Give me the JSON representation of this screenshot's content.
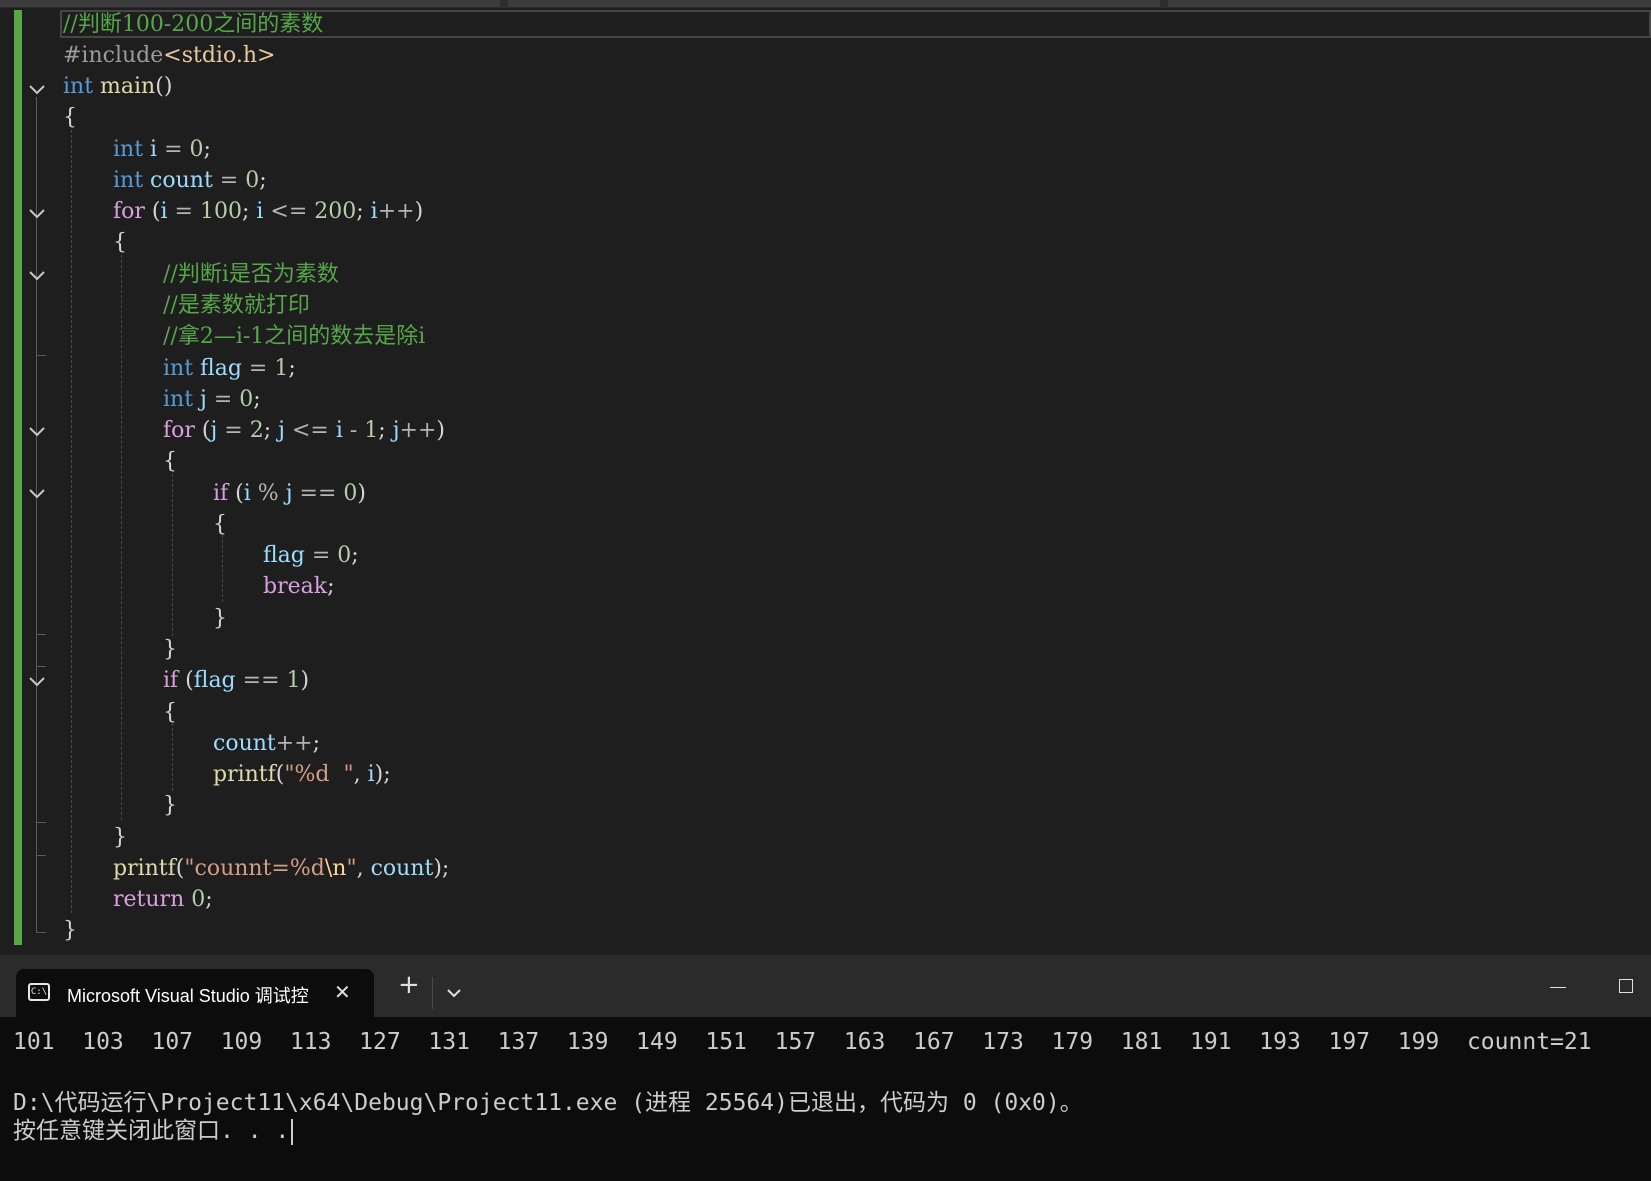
{
  "editor": {
    "lines": [
      {
        "parts": [
          {
            "t": "//判断100-200之间的素数",
            "c": "cmt"
          }
        ]
      },
      {
        "parts": [
          {
            "t": "#include",
            "c": "inc"
          },
          {
            "t": "<stdio.h>",
            "c": "incs"
          }
        ]
      },
      {
        "parts": [
          {
            "t": "int",
            "c": "kw"
          },
          {
            "t": " "
          },
          {
            "t": "main",
            "c": "fn"
          },
          {
            "t": "()"
          }
        ]
      },
      {
        "parts": [
          {
            "t": "{"
          }
        ]
      },
      {
        "parts": [
          {
            "t": "int",
            "c": "kw"
          },
          {
            "t": " "
          },
          {
            "t": "i",
            "c": "var"
          },
          {
            "t": " = ",
            "c": "op"
          },
          {
            "t": "0",
            "c": "num"
          },
          {
            "t": ";"
          }
        ]
      },
      {
        "parts": [
          {
            "t": "int",
            "c": "kw"
          },
          {
            "t": " "
          },
          {
            "t": "count",
            "c": "var"
          },
          {
            "t": " = ",
            "c": "op"
          },
          {
            "t": "0",
            "c": "num"
          },
          {
            "t": ";"
          }
        ]
      },
      {
        "parts": [
          {
            "t": "for",
            "c": "ctl"
          },
          {
            "t": " ("
          },
          {
            "t": "i",
            "c": "var"
          },
          {
            "t": " = ",
            "c": "op"
          },
          {
            "t": "100",
            "c": "num"
          },
          {
            "t": "; "
          },
          {
            "t": "i",
            "c": "var"
          },
          {
            "t": " <= ",
            "c": "op"
          },
          {
            "t": "200",
            "c": "num"
          },
          {
            "t": "; "
          },
          {
            "t": "i",
            "c": "var"
          },
          {
            "t": "++",
            "c": "op"
          },
          {
            "t": ")"
          }
        ]
      },
      {
        "parts": [
          {
            "t": "{"
          }
        ]
      },
      {
        "parts": [
          {
            "t": "//判断i是否为素数",
            "c": "cmt"
          }
        ]
      },
      {
        "parts": [
          {
            "t": "//是素数就打印",
            "c": "cmt"
          }
        ]
      },
      {
        "parts": [
          {
            "t": "//拿2—i-1之间的数去是除i",
            "c": "cmt"
          }
        ]
      },
      {
        "parts": [
          {
            "t": "int",
            "c": "kw"
          },
          {
            "t": " "
          },
          {
            "t": "flag",
            "c": "var"
          },
          {
            "t": " = ",
            "c": "op"
          },
          {
            "t": "1",
            "c": "num"
          },
          {
            "t": ";"
          }
        ]
      },
      {
        "parts": [
          {
            "t": "int",
            "c": "kw"
          },
          {
            "t": " "
          },
          {
            "t": "j",
            "c": "var"
          },
          {
            "t": " = ",
            "c": "op"
          },
          {
            "t": "0",
            "c": "num"
          },
          {
            "t": ";"
          }
        ]
      },
      {
        "parts": [
          {
            "t": "for",
            "c": "ctl"
          },
          {
            "t": " ("
          },
          {
            "t": "j",
            "c": "var"
          },
          {
            "t": " = ",
            "c": "op"
          },
          {
            "t": "2",
            "c": "num"
          },
          {
            "t": "; "
          },
          {
            "t": "j",
            "c": "var"
          },
          {
            "t": " <= ",
            "c": "op"
          },
          {
            "t": "i",
            "c": "var"
          },
          {
            "t": " - ",
            "c": "op"
          },
          {
            "t": "1",
            "c": "num"
          },
          {
            "t": "; "
          },
          {
            "t": "j",
            "c": "var"
          },
          {
            "t": "++",
            "c": "op"
          },
          {
            "t": ")"
          }
        ]
      },
      {
        "parts": [
          {
            "t": "{"
          }
        ]
      },
      {
        "parts": [
          {
            "t": "if",
            "c": "ctl"
          },
          {
            "t": " ("
          },
          {
            "t": "i",
            "c": "var"
          },
          {
            "t": " % ",
            "c": "op"
          },
          {
            "t": "j",
            "c": "var"
          },
          {
            "t": " == ",
            "c": "op"
          },
          {
            "t": "0",
            "c": "num"
          },
          {
            "t": ")"
          }
        ]
      },
      {
        "parts": [
          {
            "t": "{"
          }
        ]
      },
      {
        "parts": [
          {
            "t": "flag",
            "c": "var"
          },
          {
            "t": " = ",
            "c": "op"
          },
          {
            "t": "0",
            "c": "num"
          },
          {
            "t": ";"
          }
        ]
      },
      {
        "parts": [
          {
            "t": "break",
            "c": "ctl"
          },
          {
            "t": ";"
          }
        ]
      },
      {
        "parts": [
          {
            "t": "}"
          }
        ]
      },
      {
        "parts": [
          {
            "t": "}"
          }
        ]
      },
      {
        "parts": [
          {
            "t": "if",
            "c": "ctl"
          },
          {
            "t": " ("
          },
          {
            "t": "flag",
            "c": "var"
          },
          {
            "t": " == ",
            "c": "op"
          },
          {
            "t": "1",
            "c": "num"
          },
          {
            "t": ")"
          }
        ]
      },
      {
        "parts": [
          {
            "t": "{"
          }
        ]
      },
      {
        "parts": [
          {
            "t": "count",
            "c": "var"
          },
          {
            "t": "++",
            "c": "op"
          },
          {
            "t": ";"
          }
        ]
      },
      {
        "parts": [
          {
            "t": "printf",
            "c": "fn"
          },
          {
            "t": "("
          },
          {
            "t": "\"%d  \"",
            "c": "str"
          },
          {
            "t": ", "
          },
          {
            "t": "i",
            "c": "var"
          },
          {
            "t": ");"
          }
        ]
      },
      {
        "parts": [
          {
            "t": "}"
          }
        ]
      },
      {
        "parts": [
          {
            "t": "}"
          }
        ]
      },
      {
        "parts": [
          {
            "t": "printf",
            "c": "fn"
          },
          {
            "t": "("
          },
          {
            "t": "\"counnt=%d",
            "c": "str"
          },
          {
            "t": "\\n",
            "c": "esc"
          },
          {
            "t": "\"",
            "c": "str"
          },
          {
            "t": ", "
          },
          {
            "t": "count",
            "c": "var"
          },
          {
            "t": ");"
          }
        ]
      },
      {
        "parts": [
          {
            "t": "return",
            "c": "ctl"
          },
          {
            "t": " "
          },
          {
            "t": "0",
            "c": "num"
          },
          {
            "t": ";"
          }
        ]
      },
      {
        "parts": [
          {
            "t": "}"
          }
        ]
      }
    ]
  },
  "console": {
    "tab_title": "Microsoft Visual Studio 调试控",
    "tab_icon": "terminal-icon",
    "close_glyph": "✕",
    "new_tab_glyph": "+",
    "dropdown_glyph": "⌄",
    "minimize_glyph": "—",
    "maximize_glyph": "☐",
    "output_line1": "101  103  107  109  113  127  131  137  139  149  151  157  163  167  173  179  181  191  193  197  199  counnt=21",
    "output_line2": "D:\\代码运行\\Project11\\x64\\Debug\\Project11.exe (进程 25564)已退出，代码为 0 (0x0)。",
    "output_line3": "按任意键关闭此窗口. . ."
  }
}
